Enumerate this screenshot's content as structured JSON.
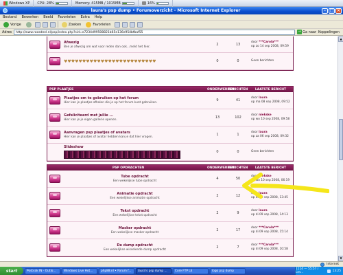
{
  "monitor": {
    "label": "Windows XP",
    "cpu": "CPU: 28%",
    "memory": "Memory: 415MB / 1015MB",
    "disk": "16%",
    "cpu_level": 0.28,
    "mem_level": 0.41,
    "disk_level": 0.16
  },
  "window": {
    "title": "laura's psp dump • Forumoverzicht - Microsoft Internet Explorer"
  },
  "menu": [
    "Bestand",
    "Bewerken",
    "Beeld",
    "Favorieten",
    "Extra",
    "Help"
  ],
  "toolbar": {
    "back": "Vorige",
    "search": "Zoeken",
    "favorites": "Favorieten"
  },
  "address": {
    "label": "Adres",
    "value": "http://www.roosdeel.nl/psp/index.php?sid=e7234d99508821b65e136e954bfbaf55",
    "go": "Ga naar",
    "links": "Koppelingen"
  },
  "section_top": {
    "rows": [
      {
        "title": "Afwezig",
        "desc": "Ben je afwezig om wat voor reden dan ook...meld het hier.",
        "topics": "2",
        "posts": "13",
        "author": "***Carola***",
        "date": "op zo 14 sep 2008, 09:59",
        "prefix": "door"
      },
      {
        "hearts": "♥♥♥♥♥♥♥♥♥♥♥♥♥♥♥♥♥♥♥♥♥♥♥♥♥",
        "topics": "0",
        "posts": "0",
        "none": "Geen berichten"
      }
    ]
  },
  "section_plaatjes": {
    "header": "PSP PLAATJES",
    "col_topics": "ONDERWERPEN",
    "col_posts": "BERICHTEN",
    "col_last": "LAATSTE BERICHT",
    "rows": [
      {
        "title": "Plaatjes om te gebruiken op het forum",
        "desc": "Hier kan je plaatjes afhalen die je op het forum kunt gebruiken.",
        "topics": "9",
        "posts": "41",
        "prefix": "door",
        "author": "laura",
        "date": "op ma 08 sep 2008, 09:52"
      },
      {
        "title": "Gefeliciteerd met jullie ...",
        "desc": "Hier kan je je eigen gallerie openen.",
        "topics": "13",
        "posts": "102",
        "prefix": "door",
        "author": "niekske",
        "date": "op wo 10 sep 2008, 09:58"
      },
      {
        "title": "Aanvragen psp plaatjes of avatars",
        "desc": "Hier kan je plaatjes of avatar hebben kan je dat hier vragen.",
        "topics": "1",
        "posts": "1",
        "prefix": "door",
        "author": "laura",
        "date": "op za 06 sep 2008, 09:32"
      },
      {
        "title": "Slideshow",
        "topics": "0",
        "posts": "0",
        "none": "Geen berichten"
      }
    ]
  },
  "section_opdrachten": {
    "header": "PSP OPDRACHTEN",
    "col_topics": "ONDERWERPEN",
    "col_posts": "BERICHTEN",
    "col_last": "LAATSTE BERICHT",
    "rows": [
      {
        "title": "Tube opdracht",
        "desc": "Een wekelijkse tube opdracht",
        "topics": "4",
        "posts": "50",
        "prefix": "door",
        "author": "niekske",
        "date": "op wo 10 sep 2008, 06:19"
      },
      {
        "title": "Animatie opdracht",
        "desc": "Een wekelijkse animatie opdracht",
        "topics": "2",
        "posts": "12",
        "prefix": "door",
        "author": "laura",
        "date": "op di 09 sep 2008, 13:45"
      },
      {
        "title": "Tekst opdracht",
        "desc": "Een wekelijkse tekst opdracht",
        "topics": "2",
        "posts": "9",
        "prefix": "door",
        "author": "laura",
        "date": "op di 09 sep 2008, 14:13"
      },
      {
        "title": "Masker opdracht",
        "desc": "Een wekelijkse masker opdracht",
        "topics": "2",
        "posts": "17",
        "prefix": "door",
        "author": "***Carola***",
        "date": "op di 09 sep 2008, 15:14"
      },
      {
        "title": "De dump opdracht",
        "desc": "Een wekelijkse wisselende dump opdracht",
        "topics": "2",
        "posts": "7",
        "prefix": "door",
        "author": "***Carola***",
        "date": "op di 09 sep 2008, 10:58"
      }
    ]
  },
  "statusbar": {
    "zone": "Internet"
  },
  "taskbar": {
    "start": "start",
    "tasks": [
      "Postvak IN - Outlo...",
      "Windows Live Hot...",
      "php88.nl • Forum f...",
      "laura's psp dump ...",
      "Core FTP LE",
      "logo psp dump"
    ],
    "tray_text": "1114 — 55:57 / Lev...",
    "clock": "13:25"
  },
  "colors": {
    "forum_header": "#7a1a50",
    "accent_arrow": "#f5e61a"
  }
}
